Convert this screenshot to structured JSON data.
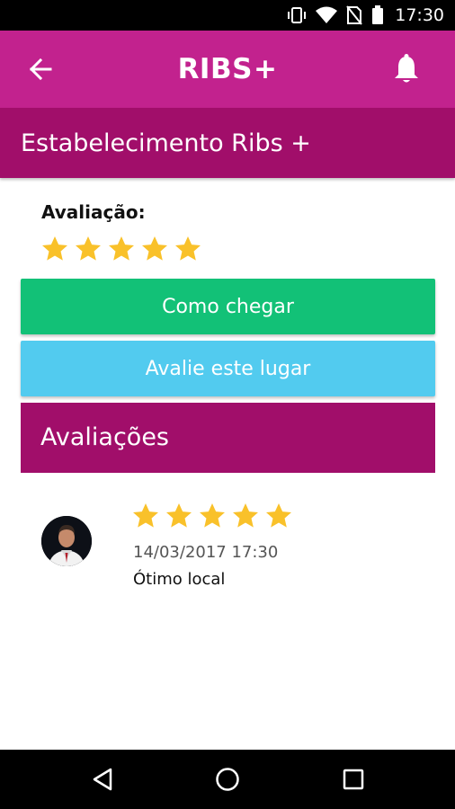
{
  "status_bar": {
    "time": "17:30",
    "icons": [
      "vibrate-icon",
      "wifi-icon",
      "no-sim-icon",
      "battery-icon"
    ]
  },
  "app_bar": {
    "logo_text": "RIBS",
    "logo_plus": "+",
    "back_icon": "arrow-left-icon",
    "notification_icon": "bell-icon"
  },
  "title_bar": {
    "title": "Estabelecimento Ribs +"
  },
  "rating": {
    "label": "Avaliação:",
    "stars": 5,
    "max_stars": 5
  },
  "buttons": {
    "directions_label": "Como chegar",
    "rate_label": "Avalie este lugar"
  },
  "reviews": {
    "header": "Avaliações",
    "items": [
      {
        "stars": 5,
        "max_stars": 5,
        "date": "14/03/2017 17:30",
        "comment": "Ótimo local",
        "avatar_icon": "user-avatar"
      }
    ]
  },
  "nav_bar": {
    "icons": [
      "nav-back-icon",
      "nav-home-icon",
      "nav-recents-icon"
    ]
  },
  "colors": {
    "app_bar": "#c2228e",
    "title_bar": "#a10e6a",
    "directions_button": "#12c177",
    "rate_button": "#52cbef",
    "star": "#f9c12a"
  }
}
